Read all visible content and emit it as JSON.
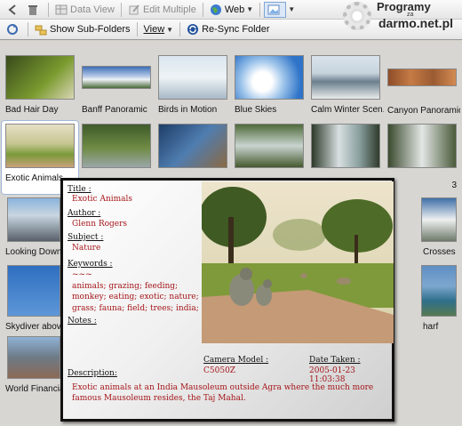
{
  "toolbar1": {
    "data_view": "Data View",
    "edit_multiple": "Edit Multiple",
    "web": "Web"
  },
  "toolbar2": {
    "show_subfolders": "Show Sub-Folders",
    "view": "View",
    "resync": "Re-Sync Folder"
  },
  "logo": {
    "line1": "Programy",
    "line2": "za",
    "line3": "darmo.net.pl"
  },
  "thumbnails_row1": [
    {
      "caption": "Bad Hair Day",
      "icon": "image-thumbnail"
    },
    {
      "caption": "Banff Panoramic",
      "icon": "image-thumbnail"
    },
    {
      "caption": "Birds in Motion",
      "icon": "image-thumbnail"
    },
    {
      "caption": "Blue Skies",
      "icon": "image-thumbnail"
    },
    {
      "caption": "Calm Winter Scen...",
      "icon": "image-thumbnail"
    },
    {
      "caption": "Canyon Panoramic",
      "icon": "image-thumbnail"
    }
  ],
  "thumbnails_row2": [
    {
      "caption": "Exotic Animals"
    },
    {
      "caption": ""
    },
    {
      "caption": ""
    },
    {
      "caption": ""
    },
    {
      "caption": ""
    },
    {
      "caption": "3"
    }
  ],
  "left_column": {
    "looking_down": "Looking Down",
    "crosses": "Crosses",
    "skydiver": "Skydiver above",
    "harf": "harf",
    "world_financial": "World Financial"
  },
  "tooltip": {
    "title_label": "Title :",
    "title_value": "Exotic Animals",
    "author_label": "Author :",
    "author_value": "Glenn Rogers",
    "subject_label": "Subject :",
    "subject_value": "Nature",
    "keywords_label": "Keywords :",
    "keywords_value": [
      "~~~",
      "animals; grazing; feeding;",
      "monkey; eating; exotic; nature;",
      "grass; fauna; field; trees; india;"
    ],
    "notes_label": "Notes :",
    "camera_label": "Camera Model :",
    "camera_value": "C5050Z",
    "date_label": "Date Taken :",
    "date_value": "2005-01-23 11:03:38",
    "description_label": "Description:",
    "description_value": "Exotic animals at an India Mausoleum outside Agra where the much more famous Mausoleum resides, the Taj Mahal."
  },
  "colors": {
    "metadata_value": "#a5161a",
    "background": "#d7d6d2"
  }
}
